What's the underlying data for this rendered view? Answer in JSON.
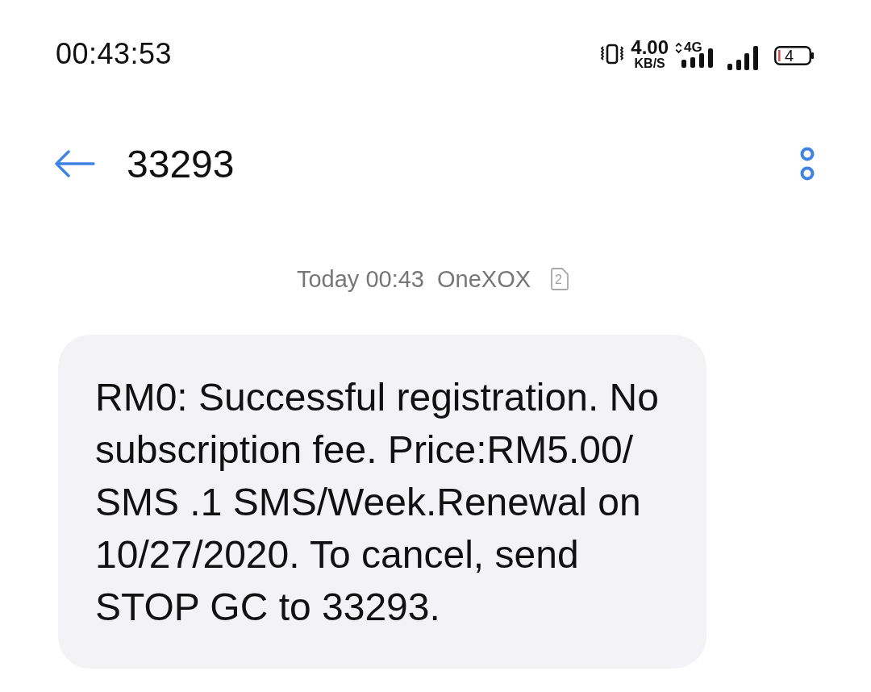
{
  "status_bar": {
    "time": "00:43:53",
    "network_speed": {
      "value": "4.00",
      "unit": "KB/S"
    },
    "network_type": "4G",
    "battery_percent": "4"
  },
  "header": {
    "title": "33293"
  },
  "messages": [
    {
      "timestamp": "Today 00:43",
      "sim_label": "OneXOX",
      "sim_slot": "2",
      "text": "RM0: Successful registration. No subscription fee. Price:RM5.00/SMS .1 SMS/Week.Renewal on 10/27/2020. To cancel, send STOP GC to 33293."
    }
  ]
}
